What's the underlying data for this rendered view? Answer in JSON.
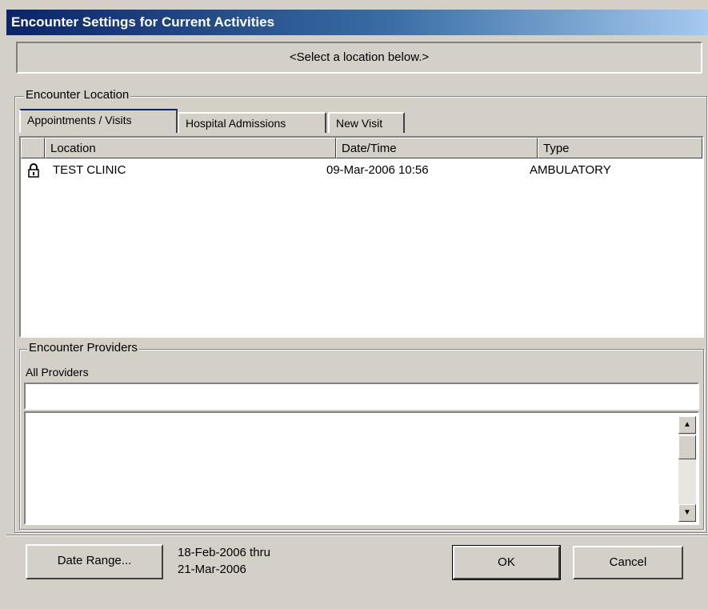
{
  "window": {
    "title": "Encounter Settings for Current Activities"
  },
  "message": "<Select a location below.>",
  "encounter_location": {
    "group_label": "Encounter Location",
    "tabs": [
      {
        "label": "Appointments / Visits",
        "active": true
      },
      {
        "label": "Hospital Admissions",
        "active": false
      },
      {
        "label": "New Visit",
        "active": false
      }
    ],
    "columns": [
      "Location",
      "Date/Time",
      "Type"
    ],
    "rows": [
      {
        "icon": "lock-icon",
        "location": "TEST CLINIC",
        "datetime": "09-Mar-2006 10:56",
        "type": "AMBULATORY"
      }
    ]
  },
  "encounter_providers": {
    "group_label": "Encounter Providers",
    "filter_label": "All Providers",
    "filter_value": "",
    "list": []
  },
  "footer": {
    "date_range_button": "Date Range...",
    "range_start": "18-Feb-2006 thru",
    "range_end": "21-Mar-2006",
    "ok_button": "OK",
    "cancel_button": "Cancel"
  }
}
